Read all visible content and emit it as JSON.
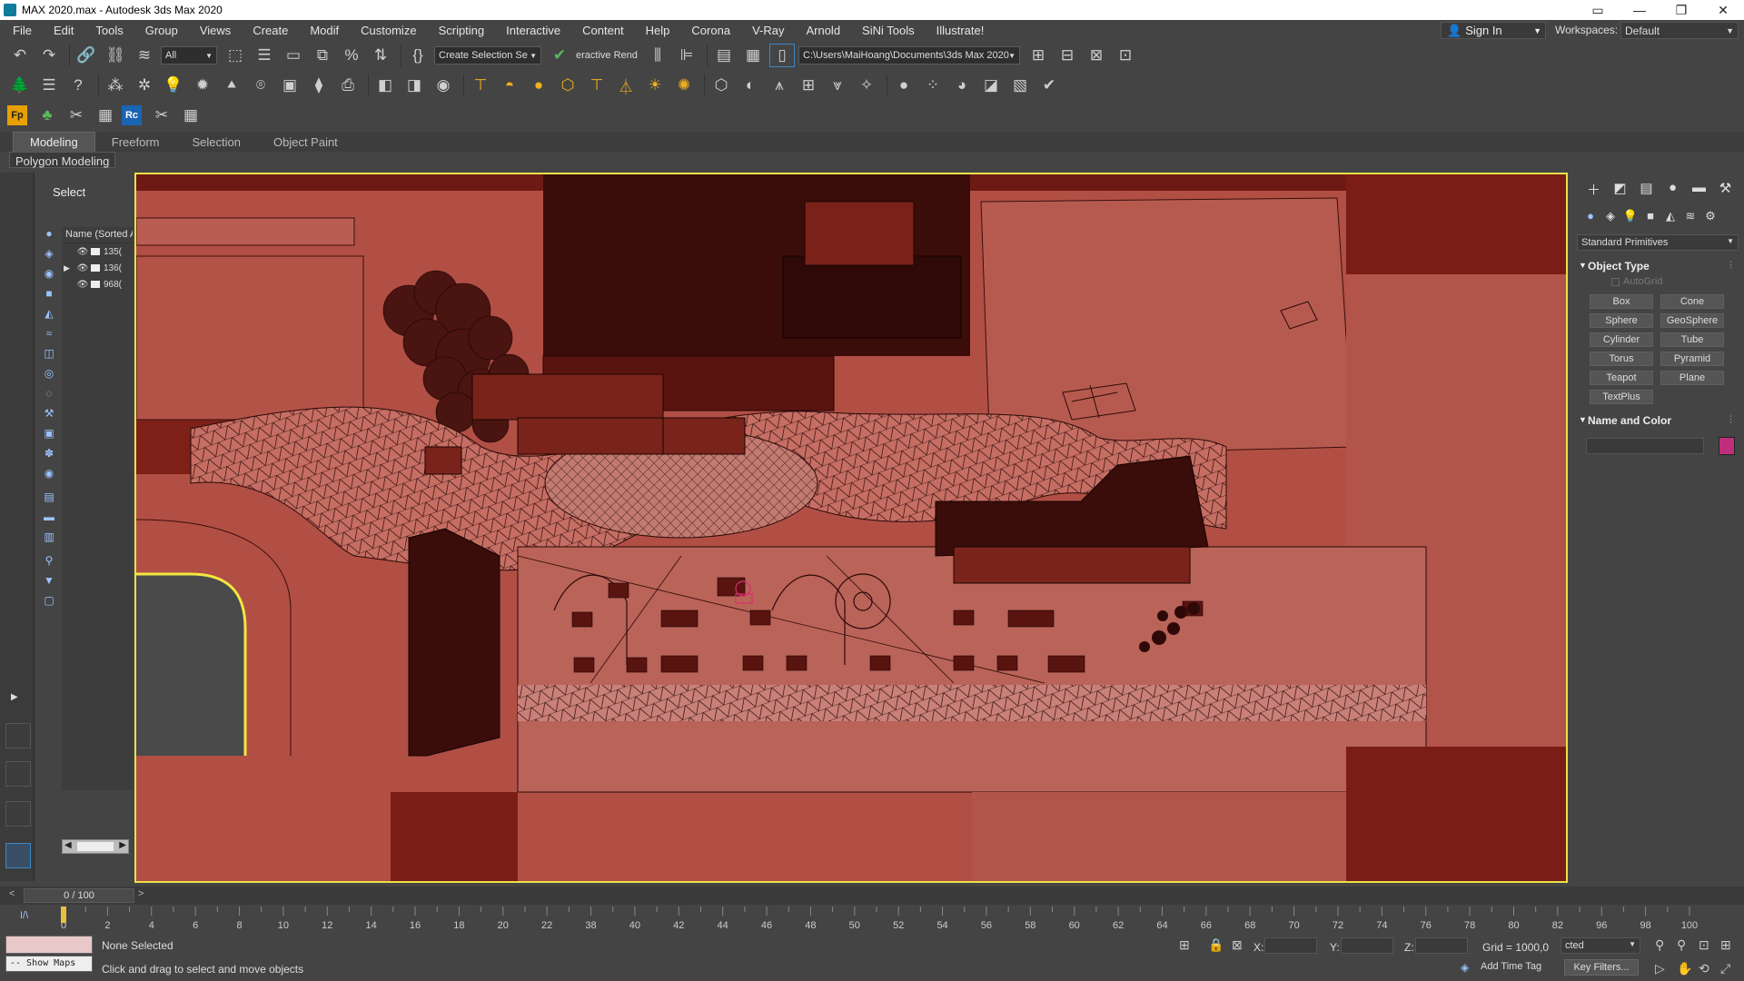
{
  "window": {
    "title": "MAX 2020.max - Autodesk 3ds Max 2020",
    "controls": [
      "▭",
      "—",
      "❐",
      "✕"
    ]
  },
  "menu": [
    "File",
    "Edit",
    "Tools",
    "Group",
    "Views",
    "Create",
    "Modif",
    "Customize",
    "Scripting",
    "Interactive",
    "Content",
    "Help",
    "Corona",
    "V-Ray",
    "Arnold",
    "SiNi Tools",
    "Illustrate!"
  ],
  "account": {
    "signin": "Sign In",
    "workspaces_label": "Workspaces:",
    "workspace": "Default"
  },
  "toolbar": {
    "selection_filter": "All",
    "named_selection": "Create Selection Se",
    "render_label": "eractive Rend",
    "project_path": "C:\\Users\\MaiHoang\\Documents\\3ds Max 2020"
  },
  "ribbon": {
    "tabs": [
      "Modeling",
      "Freeform",
      "Selection",
      "Object Paint"
    ],
    "active": "Modeling",
    "panel": "Polygon Modeling"
  },
  "explorer": {
    "title": "Select",
    "column": "Name (Sorted A",
    "rows": [
      {
        "name": "135("
      },
      {
        "name": "136("
      },
      {
        "name": "968("
      }
    ]
  },
  "command_panel": {
    "category": "Standard Primitives",
    "object_type_title": "Object Type",
    "autogrid": "AutoGrid",
    "buttons": [
      "Box",
      "Cone",
      "Sphere",
      "GeoSphere",
      "Cylinder",
      "Tube",
      "Torus",
      "Pyramid",
      "Teapot",
      "Plane",
      "TextPlus"
    ],
    "name_color_title": "Name and Color",
    "color": "#c02e7b"
  },
  "timeline": {
    "range": "0 / 100",
    "ticks": [
      "0",
      "2",
      "4",
      "6",
      "8",
      "10",
      "12",
      "14",
      "16",
      "18",
      "20",
      "22",
      "38",
      "40",
      "42",
      "44",
      "46",
      "48",
      "50",
      "52",
      "54",
      "56",
      "58",
      "60",
      "62",
      "64",
      "66",
      "68",
      "70",
      "72",
      "74",
      "76",
      "78",
      "80",
      "82",
      "96",
      "98",
      "100"
    ]
  },
  "status": {
    "selection": "None Selected",
    "prompt": "Click and drag to select and move objects",
    "show_maps": "-- Show Maps",
    "x_label": "X:",
    "y_label": "Y:",
    "z_label": "Z:",
    "grid": "Grid = 1000,0",
    "add_time_tag": "Add Time Tag",
    "key_mode": "cted",
    "key_filters": "Key Filters..."
  }
}
